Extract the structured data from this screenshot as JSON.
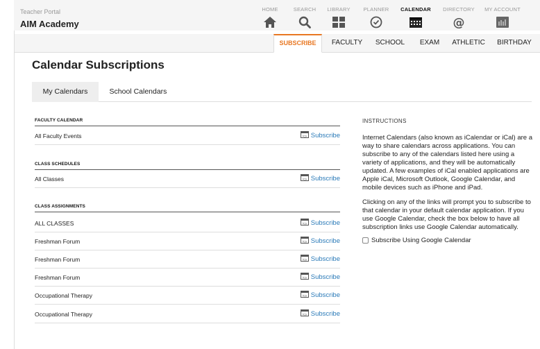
{
  "header": {
    "portal_label": "Teacher Portal",
    "school_name": "AIM Academy",
    "nav": [
      {
        "label": "HOME",
        "icon": "home-icon"
      },
      {
        "label": "SEARCH",
        "icon": "search-icon"
      },
      {
        "label": "LIBRARY",
        "icon": "library-icon"
      },
      {
        "label": "PLANNER",
        "icon": "planner-icon"
      },
      {
        "label": "CALENDAR",
        "icon": "calendar-icon",
        "active": true
      },
      {
        "label": "DIRECTORY",
        "icon": "at-icon"
      },
      {
        "label": "MY ACCOUNT",
        "icon": "account-icon"
      }
    ]
  },
  "subtabs": [
    "SUBSCRIBE",
    "FACULTY",
    "SCHOOL",
    "EXAM",
    "ATHLETIC",
    "BIRTHDAY"
  ],
  "page_title": "Calendar Subscriptions",
  "calendar_tabs": [
    "My Calendars",
    "School Calendars"
  ],
  "sections": {
    "faculty": {
      "heading": "FACULTY CALENDAR",
      "rows": [
        {
          "name": "All Faculty Events",
          "action": "Subscribe"
        }
      ]
    },
    "class_schedules": {
      "heading": "CLASS SCHEDULES",
      "rows": [
        {
          "name": "All Classes",
          "action": "Subscribe"
        }
      ]
    },
    "class_assignments": {
      "heading": "CLASS ASSIGNMENTS",
      "rows": [
        {
          "name": "ALL CLASSES",
          "action": "Subscribe"
        },
        {
          "name": "Freshman Forum",
          "action": "Subscribe"
        },
        {
          "name": "Freshman Forum",
          "action": "Subscribe"
        },
        {
          "name": "Freshman Forum",
          "action": "Subscribe"
        },
        {
          "name": "Occupational Therapy",
          "action": "Subscribe"
        },
        {
          "name": "Occupational Therapy",
          "action": "Subscribe"
        }
      ]
    }
  },
  "instructions": {
    "heading": "INSTRUCTIONS",
    "paragraph1": "Internet Calendars (also known as iCalendar or iCal) are a way to share calendars across applications. You can subscribe to any of the calendars listed here using a variety of applications, and they will be automatically updated. A few examples of iCal enabled applications are Apple iCal, Microsoft Outlook, Google Calendar, and mobile devices such as iPhone and iPad.",
    "paragraph2": "Clicking on any of the links will prompt you to subscribe to that calendar in your default calendar application. If you use Google Calendar, check the box below to have all subscription links use Google Calendar automatically.",
    "checkbox_label": "Subscribe Using Google Calendar"
  },
  "colors": {
    "accent": "#e87722",
    "link": "#2a7ab8"
  }
}
